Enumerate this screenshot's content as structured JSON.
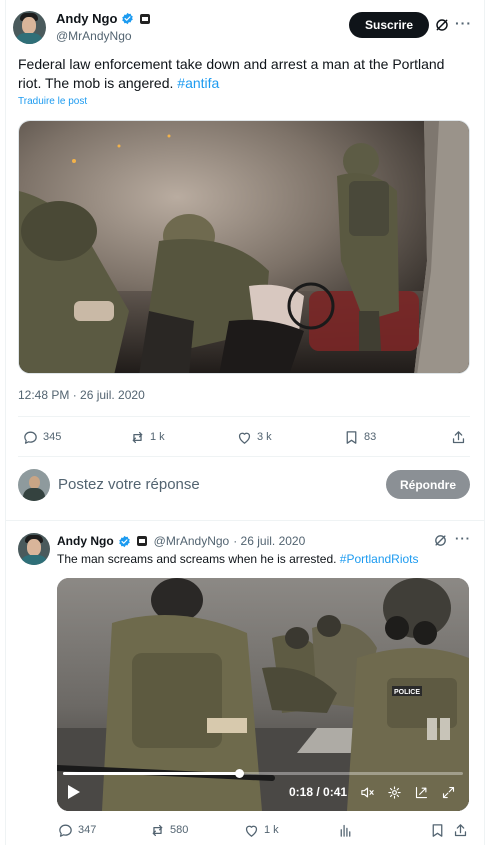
{
  "main_tweet": {
    "author_name": "Andy Ngo",
    "author_handle": "@MrAndyNgo",
    "subscribe_label": "Suscrire",
    "text": "Federal law enforcement take down and arrest a man at the Portland riot. The mob is angered.",
    "hashtag": "#antifa",
    "translate_label": "Traduire le post",
    "timestamp": "12:48 PM · 26 juil. 2020",
    "stats": {
      "replies": "345",
      "reposts": "1 k",
      "likes": "3 k",
      "bookmarks": "83"
    }
  },
  "reply_box": {
    "placeholder": "Postez votre réponse",
    "reply_label": "Répondre"
  },
  "second_tweet": {
    "author_name": "Andy Ngo",
    "author_handle": "@MrAndyNgo",
    "date": "· 26 juil. 2020",
    "text": "The man screams and screams when he is arrested.",
    "hashtag": "#PortlandRiots",
    "video": {
      "time": "0:18 / 0:41",
      "progress": 0.44
    },
    "stats": {
      "replies": "347",
      "reposts": "580",
      "likes": "1 k"
    },
    "patch_text": "POLICE"
  },
  "colors": {
    "accent": "#1d9bf0",
    "text": "#0f1419",
    "muted": "#536471",
    "subscribe_bg": "#0f1419",
    "reply_button_bg": "#8b9095"
  }
}
